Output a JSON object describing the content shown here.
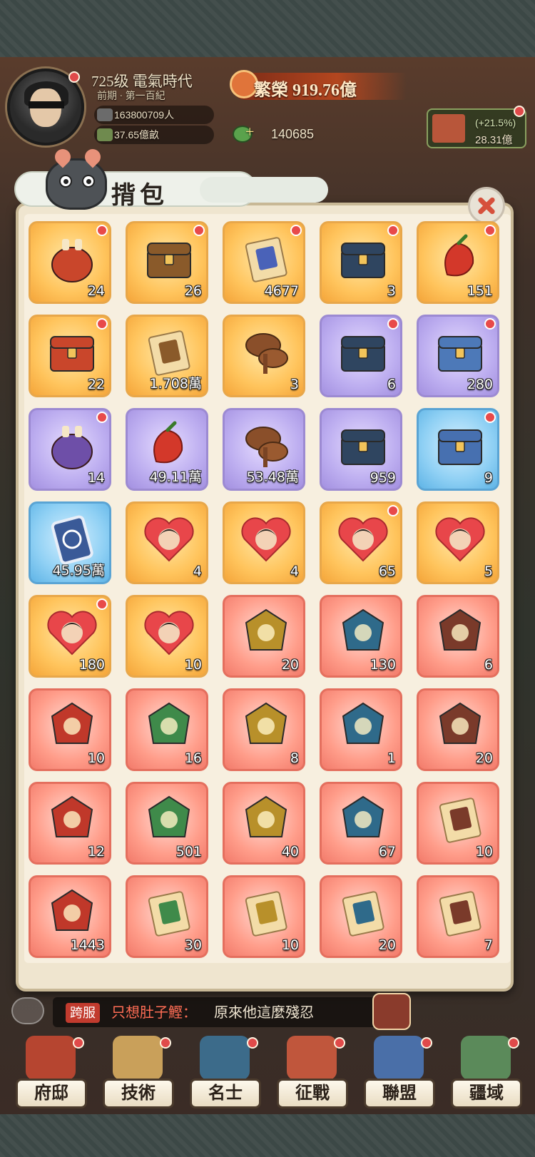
{
  "player": {
    "level": "725级",
    "era": "電氣時代",
    "sub_era": "前期 · 第一百紀",
    "population": "163800709人",
    "land": "37.65億畝",
    "prosperity_label": "繁榮",
    "prosperity_value": "919.76億",
    "coins": "140685",
    "bonus_pct": "(+21.5%)",
    "bonus_value": "28.31億"
  },
  "bag": {
    "title": "揹包",
    "items": [
      {
        "name": "bag-gold",
        "count": "24",
        "rarity": "orange",
        "dot": true
      },
      {
        "name": "treasure-chest-open",
        "count": "26",
        "rarity": "orange",
        "dot": true
      },
      {
        "name": "scroll-card",
        "count": "4677",
        "rarity": "orange",
        "dot": true
      },
      {
        "name": "blue-chest",
        "count": "3",
        "rarity": "orange",
        "dot": true
      },
      {
        "name": "chili-pepper",
        "count": "151",
        "rarity": "orange",
        "dot": true
      },
      {
        "name": "card-chest",
        "count": "22",
        "rarity": "orange",
        "dot": true
      },
      {
        "name": "land-deed",
        "count": "1.708萬",
        "rarity": "orange",
        "dot": false
      },
      {
        "name": "lingzhi-mushroom",
        "count": "3",
        "rarity": "orange",
        "dot": false
      },
      {
        "name": "gold-chest",
        "count": "6",
        "rarity": "purple",
        "dot": true
      },
      {
        "name": "puzzle-chest",
        "count": "280",
        "rarity": "purple",
        "dot": true
      },
      {
        "name": "bag-purple",
        "count": "14",
        "rarity": "purple",
        "dot": true
      },
      {
        "name": "red-pepper",
        "count": "49.11萬",
        "rarity": "purple",
        "dot": false
      },
      {
        "name": "lingzhi-mushroom-purple",
        "count": "53.48萬",
        "rarity": "purple",
        "dot": false
      },
      {
        "name": "blue-chest-purple",
        "count": "959",
        "rarity": "purple",
        "dot": false
      },
      {
        "name": "blue-puzzle-chest",
        "count": "9",
        "rarity": "blue",
        "dot": true
      },
      {
        "name": "moon-card",
        "count": "45.95萬",
        "rarity": "blue",
        "dot": false
      },
      {
        "name": "heart-portrait-1",
        "count": "4",
        "rarity": "orange",
        "dot": false
      },
      {
        "name": "heart-portrait-2",
        "count": "4",
        "rarity": "orange",
        "dot": false
      },
      {
        "name": "heart-portrait-3",
        "count": "65",
        "rarity": "orange",
        "dot": true
      },
      {
        "name": "heart-portrait-4",
        "count": "5",
        "rarity": "orange",
        "dot": false
      },
      {
        "name": "heart-portrait-5",
        "count": "180",
        "rarity": "orange",
        "dot": true
      },
      {
        "name": "heart-portrait-6",
        "count": "10",
        "rarity": "orange",
        "dot": false
      },
      {
        "name": "strawberries",
        "count": "20",
        "rarity": "red",
        "dot": false
      },
      {
        "name": "golden-token",
        "count": "130",
        "rarity": "red",
        "dot": false
      },
      {
        "name": "portrait-gem",
        "count": "6",
        "rarity": "red",
        "dot": false
      },
      {
        "name": "blue-book",
        "count": "10",
        "rarity": "red",
        "dot": false
      },
      {
        "name": "jade-stone",
        "count": "16",
        "rarity": "red",
        "dot": false
      },
      {
        "name": "jade-crystal",
        "count": "8",
        "rarity": "red",
        "dot": false
      },
      {
        "name": "ox-mask",
        "count": "1",
        "rarity": "red",
        "dot": false
      },
      {
        "name": "gold-tablet",
        "count": "20",
        "rarity": "red",
        "dot": false
      },
      {
        "name": "portrait-gem-2",
        "count": "12",
        "rarity": "red",
        "dot": false
      },
      {
        "name": "lotus-orb",
        "count": "501",
        "rarity": "red",
        "dot": false
      },
      {
        "name": "blue-relic",
        "count": "40",
        "rarity": "red",
        "dot": false
      },
      {
        "name": "jade-seal",
        "count": "67",
        "rarity": "red",
        "dot": false
      },
      {
        "name": "gold-scroll",
        "count": "10",
        "rarity": "red",
        "dot": false
      },
      {
        "name": "armor-plates",
        "count": "1443",
        "rarity": "red",
        "dot": false
      },
      {
        "name": "sword-scroll",
        "count": "30",
        "rarity": "red",
        "dot": false
      },
      {
        "name": "crossbow-scroll",
        "count": "10",
        "rarity": "red",
        "dot": false
      },
      {
        "name": "dragon-blade-scroll",
        "count": "20",
        "rarity": "red",
        "dot": false
      },
      {
        "name": "gold-gem-scroll",
        "count": "7",
        "rarity": "red",
        "dot": false
      }
    ]
  },
  "chat": {
    "tag": "跨服",
    "name": "只想肚子鰹：",
    "message": "原來他這麼殘忍"
  },
  "nav": [
    {
      "label": "府邸",
      "color": "#b64530"
    },
    {
      "label": "技術",
      "color": "#c9a05a"
    },
    {
      "label": "名士",
      "color": "#3c6b8a"
    },
    {
      "label": "征戰",
      "color": "#c0563c"
    },
    {
      "label": "聯盟",
      "color": "#4a6fa8"
    },
    {
      "label": "疆域",
      "color": "#5b8a5a"
    }
  ],
  "colors": {
    "orange": "#ffc45c",
    "purple": "#bdaef0",
    "blue": "#8fd0f4",
    "red": "#ff9d8a",
    "accent_red": "#e04a4a"
  }
}
